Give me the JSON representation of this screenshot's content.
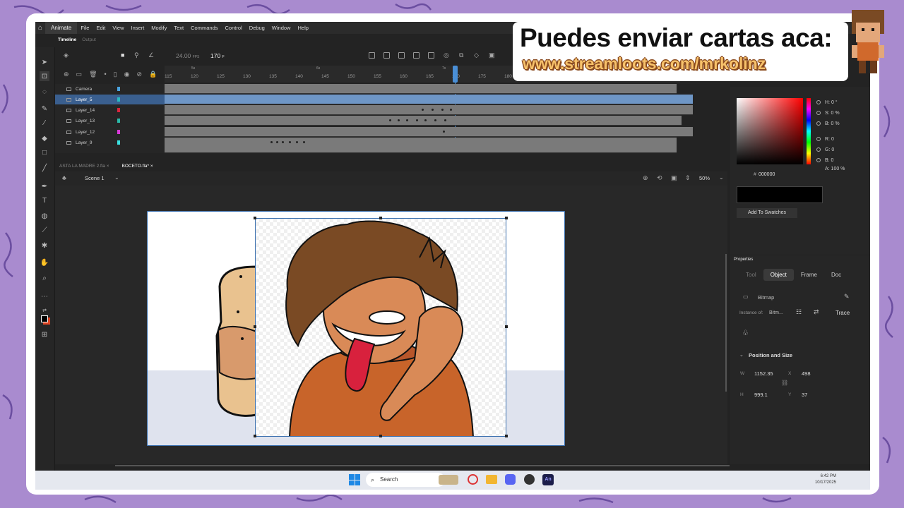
{
  "menu": {
    "app_name": "Animate",
    "items": [
      "File",
      "Edit",
      "View",
      "Insert",
      "Modify",
      "Text",
      "Commands",
      "Control",
      "Debug",
      "Window",
      "Help"
    ]
  },
  "timeline": {
    "tabs": [
      "Timeline",
      "Output"
    ],
    "fps": "24.00",
    "fps_unit": "FPS",
    "current_frame": "170",
    "frame_unit": "F",
    "ruler_ticks": [
      "115",
      "120",
      "125",
      "130",
      "135",
      "140",
      "145",
      "150",
      "155",
      "160",
      "165",
      "170",
      "175",
      "180"
    ],
    "ruler_markers": [
      "5s",
      "6s",
      "7s"
    ],
    "layers": [
      {
        "name": "Camera",
        "color": "#4aa3df"
      },
      {
        "name": "Layer_5",
        "color": "#2ab9c0",
        "selected": true
      },
      {
        "name": "Layer_14",
        "color": "#d7263d"
      },
      {
        "name": "Layer_13",
        "color": "#2ab9a8"
      },
      {
        "name": "Layer_12",
        "color": "#d63ad6"
      },
      {
        "name": "Layer_9",
        "color": "#3ae0e0"
      }
    ]
  },
  "document_tabs": [
    {
      "label": "ASTA LA MADRE 2.fla",
      "active": false
    },
    {
      "label": "BOCETO.fla*",
      "active": true
    }
  ],
  "scene": {
    "name": "Scene 1",
    "zoom": "50%"
  },
  "color_panel": {
    "h": "H: 0 °",
    "s": "S: 0 %",
    "b": "B: 0 %",
    "r": "R: 0",
    "g": "G: 0",
    "bl": "B: 0",
    "alpha": "A: 100 %",
    "hex_prefix": "#",
    "hex": "000000",
    "add_swatch": "Add To Swatches"
  },
  "properties": {
    "title": "Properties",
    "tabs": [
      "Tool",
      "Object",
      "Frame",
      "Doc"
    ],
    "active_tab": "Object",
    "type": "Bitmap",
    "instance_of_label": "Instance of:",
    "instance_of": "Bitm...",
    "trace": "Trace",
    "section": "Position and Size",
    "w_label": "W",
    "w": "1152.35",
    "x_label": "X",
    "x": "498",
    "h_label": "H",
    "h": "999.1",
    "y_label": "Y",
    "y": "37"
  },
  "taskbar": {
    "search": "Search",
    "time": "6:42 PM",
    "date": "10/17/2025"
  },
  "overlay": {
    "line1": "Puedes enviar cartas aca:",
    "line2": "www.streamloots.com/mrkolinz"
  }
}
